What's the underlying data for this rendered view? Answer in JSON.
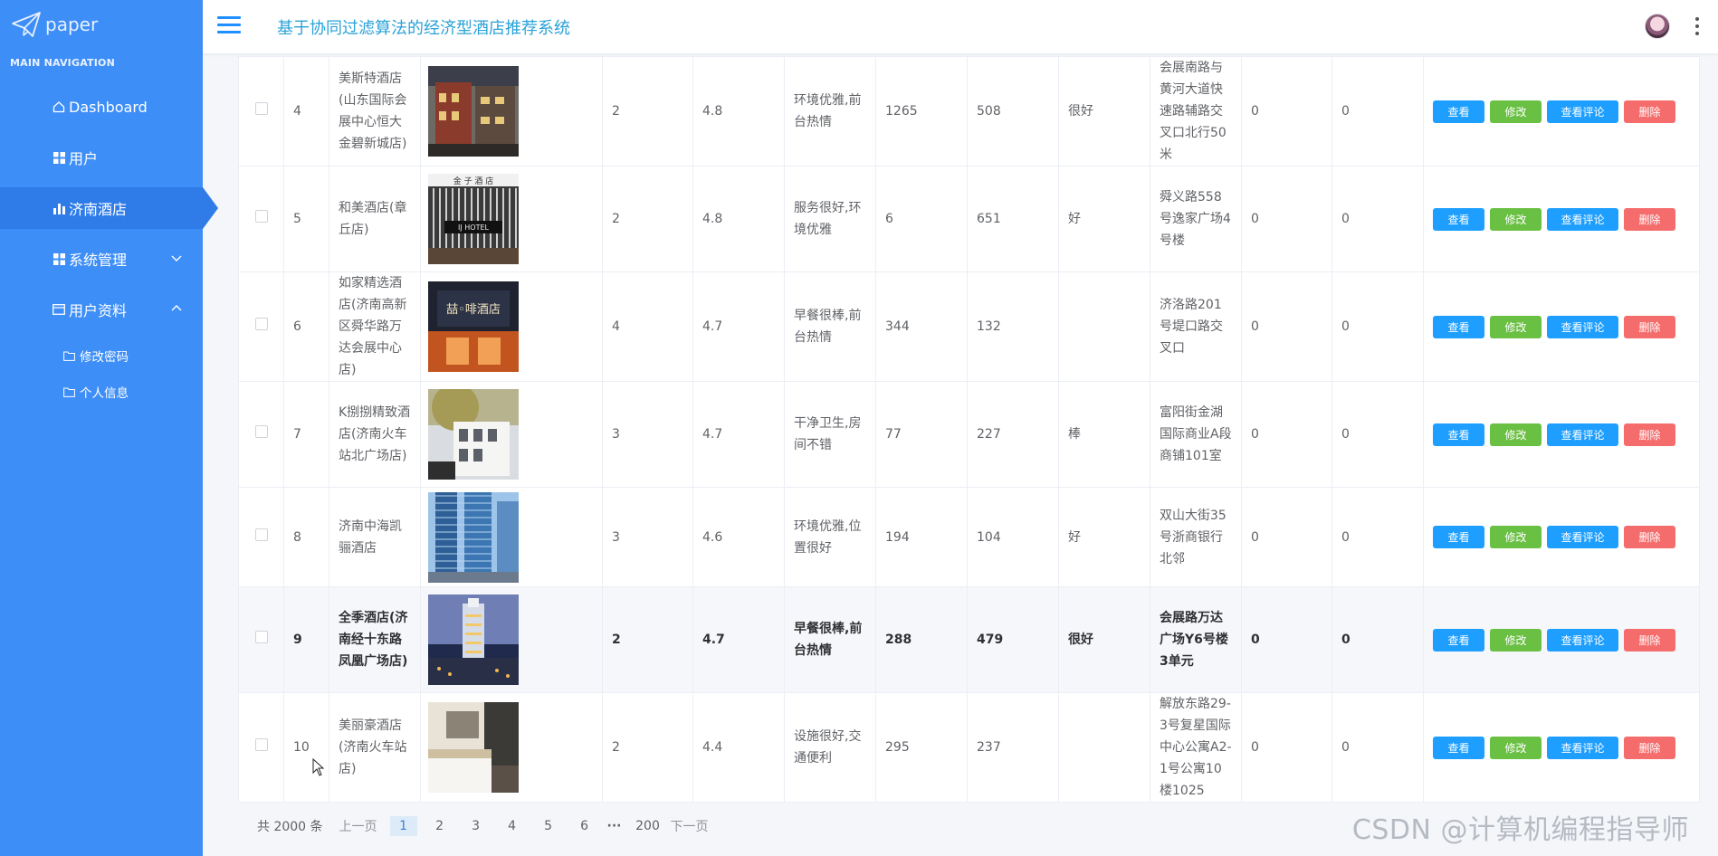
{
  "logo": {
    "text": "paper"
  },
  "sidebar": {
    "section_label": "MAIN NAVIGATION",
    "items": [
      {
        "label": "Dashboard",
        "icon": "home-icon"
      },
      {
        "label": "用户",
        "icon": "grid-icon"
      },
      {
        "label": "济南酒店",
        "icon": "bar-chart-icon"
      },
      {
        "label": "系统管理",
        "icon": "grid-icon"
      },
      {
        "label": "用户资料",
        "icon": "card-icon"
      }
    ],
    "subitems": [
      {
        "label": "修改密码",
        "icon": "folder-icon"
      },
      {
        "label": "个人信息",
        "icon": "folder-icon"
      }
    ]
  },
  "header": {
    "title": "基于协同过滤算法的经济型酒店推荐系统"
  },
  "actions": {
    "view": "查看",
    "edit": "修改",
    "review": "查看评论",
    "delete": "删除"
  },
  "rows": [
    {
      "id": "4",
      "name": "美斯特酒店(山东国际会展中心恒大金碧新城店)",
      "col_a": "2",
      "score": "4.8",
      "review": "环境优雅,前台热情",
      "n1": "1265",
      "n2": "508",
      "rating": "很好",
      "address": "会展南路与黄河大道快速路辅路交叉口北行50米",
      "x1": "0",
      "x2": "0"
    },
    {
      "id": "5",
      "name": "和美酒店(章丘店)",
      "col_a": "2",
      "score": "4.8",
      "review": "服务很好,环境优雅",
      "n1": "6",
      "n2": "651",
      "rating": "好",
      "address": "舜义路558号逸家广场4号楼",
      "x1": "0",
      "x2": "0"
    },
    {
      "id": "6",
      "name": "如家精选酒店(济南高新区舜华路万达会展中心店)",
      "col_a": "4",
      "score": "4.7",
      "review": "早餐很棒,前台热情",
      "n1": "344",
      "n2": "132",
      "rating": "",
      "address": "济洛路201号堤口路交叉口",
      "x1": "0",
      "x2": "0"
    },
    {
      "id": "7",
      "name": "K捌捌精致酒店(济南火车站北广场店)",
      "col_a": "3",
      "score": "4.7",
      "review": "干净卫生,房间不错",
      "n1": "77",
      "n2": "227",
      "rating": "棒",
      "address": "富阳街金湖国际商业A段商铺101室",
      "x1": "0",
      "x2": "0"
    },
    {
      "id": "8",
      "name": "济南中海凯骊酒店",
      "col_a": "3",
      "score": "4.6",
      "review": "环境优雅,位置很好",
      "n1": "194",
      "n2": "104",
      "rating": "好",
      "address": "双山大街35号浙商银行北邻",
      "x1": "0",
      "x2": "0"
    },
    {
      "id": "9",
      "name": "全季酒店(济南经十东路凤凰广场店)",
      "col_a": "2",
      "score": "4.7",
      "review": "早餐很棒,前台热情",
      "n1": "288",
      "n2": "479",
      "rating": "很好",
      "address": "会展路万达广场Y6号楼3单元",
      "x1": "0",
      "x2": "0"
    },
    {
      "id": "10",
      "name": "美丽豪酒店(济南火车站店)",
      "col_a": "2",
      "score": "4.4",
      "review": "设施很好,交通便利",
      "n1": "295",
      "n2": "237",
      "rating": "",
      "address": "解放东路29-3号复星国际中心公寓A2-1号公寓10楼1025",
      "x1": "0",
      "x2": "0"
    }
  ],
  "thumb_signs": {
    "row5": "金 子 酒 店",
    "row5_sub": "IJ HOTEL",
    "row6": "喆◦啡酒店"
  },
  "pagination": {
    "total": "共 2000 条",
    "prev": "上一页",
    "pages": [
      "1",
      "2",
      "3",
      "4",
      "5",
      "6"
    ],
    "ellipsis": "···",
    "last": "200",
    "next": "下一页",
    "current": "1"
  },
  "watermark": "CSDN @计算机编程指导师"
}
